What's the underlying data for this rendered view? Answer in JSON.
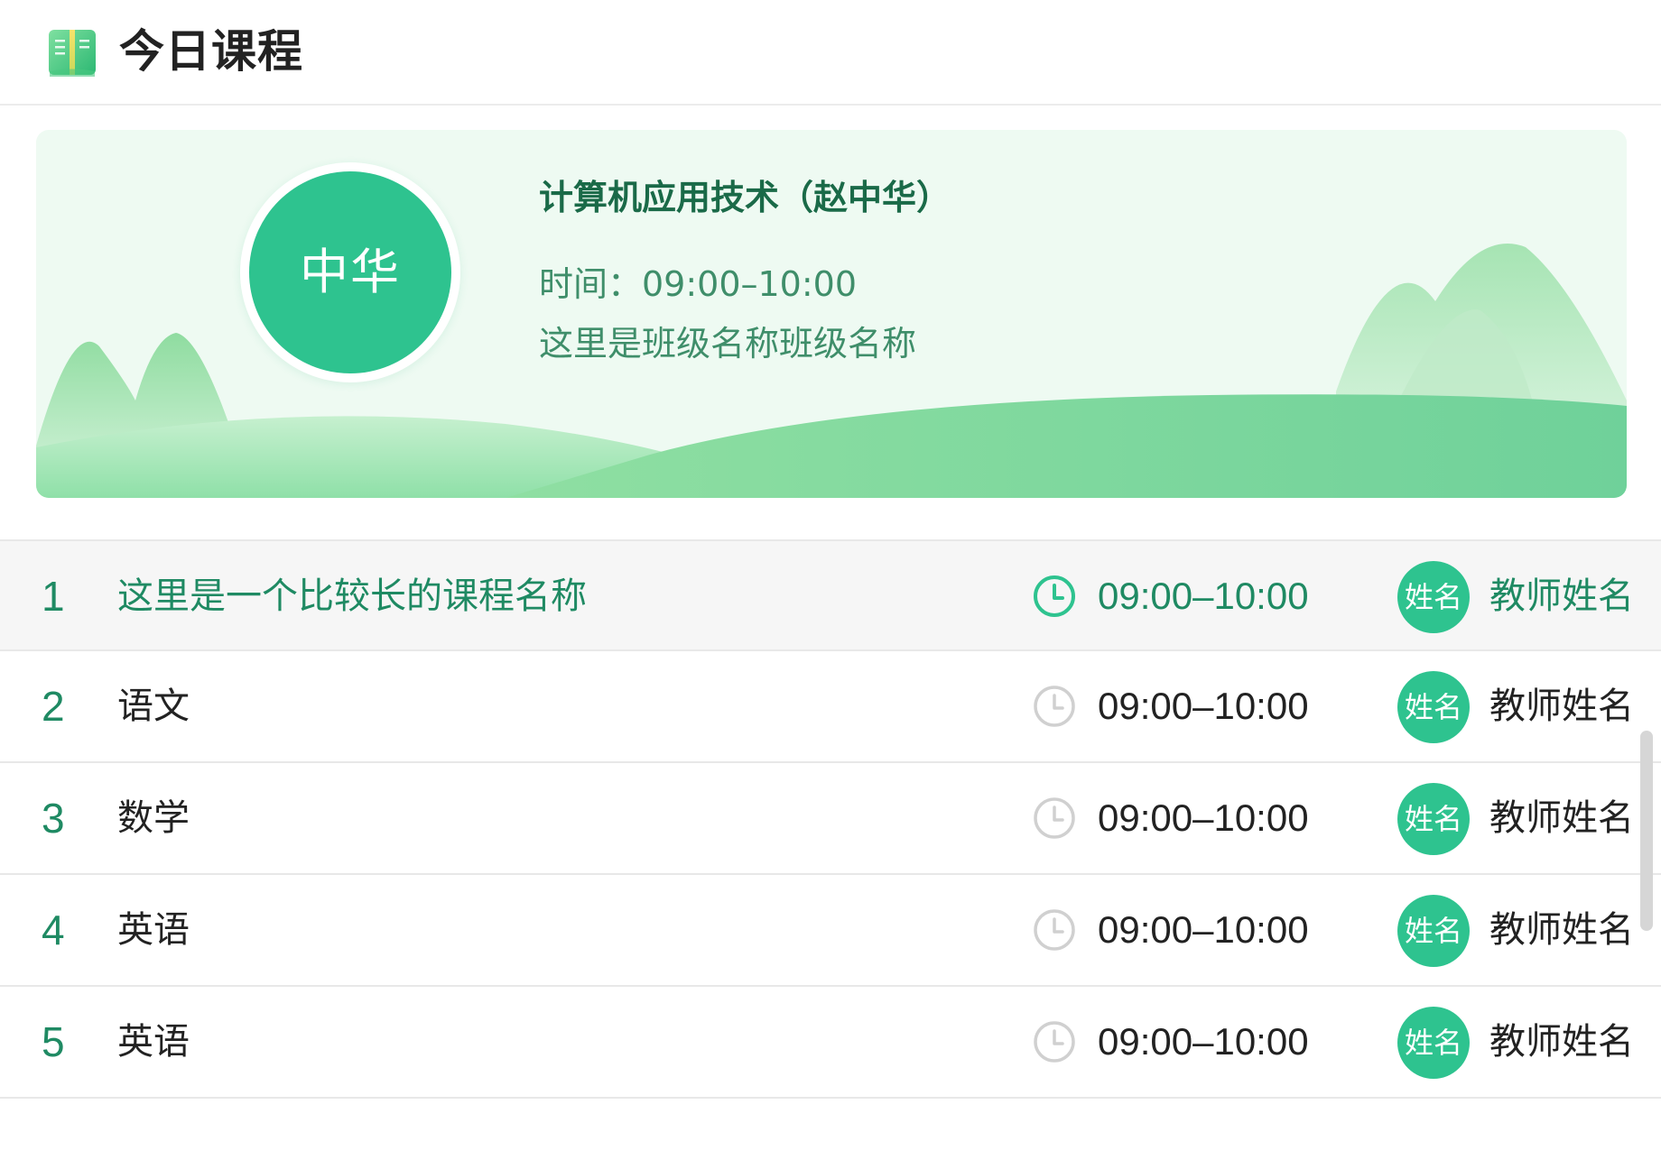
{
  "header": {
    "title": "今日课程",
    "icon": "book-icon"
  },
  "current_course": {
    "avatar_text": "中华",
    "title": "计算机应用技术（赵中华）",
    "time_label": "时间：09:00–10:00",
    "class_name": "这里是班级名称班级名称"
  },
  "courses": [
    {
      "index": "1",
      "name": "这里是一个比较长的课程名称",
      "time": "09:00–10:00",
      "teacher_avatar": "姓名",
      "teacher": "教师姓名",
      "active": true
    },
    {
      "index": "2",
      "name": "语文",
      "time": "09:00–10:00",
      "teacher_avatar": "姓名",
      "teacher": "教师姓名",
      "active": false
    },
    {
      "index": "3",
      "name": "数学",
      "time": "09:00–10:00",
      "teacher_avatar": "姓名",
      "teacher": "教师姓名",
      "active": false
    },
    {
      "index": "4",
      "name": "英语",
      "time": "09:00–10:00",
      "teacher_avatar": "姓名",
      "teacher": "教师姓名",
      "active": false
    },
    {
      "index": "5",
      "name": "英语",
      "time": "09:00–10:00",
      "teacher_avatar": "姓名",
      "teacher": "教师姓名",
      "active": false
    }
  ],
  "colors": {
    "accent": "#2ec38f",
    "accent_dark": "#1f8a63",
    "banner_bg": "#eefaf2",
    "active_row_bg": "#f6f6f6",
    "inactive_clock": "#d0d0d0"
  }
}
